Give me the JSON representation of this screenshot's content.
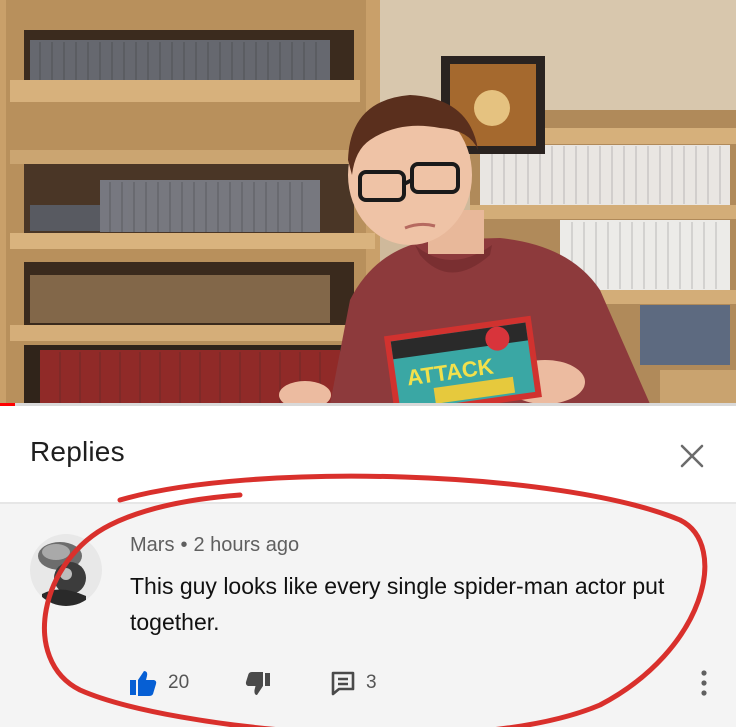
{
  "video": {
    "progress_fraction": 0.02,
    "box_art_text": "ATTACK"
  },
  "replies": {
    "title": "Replies",
    "close_icon": "close-icon"
  },
  "comment": {
    "author": "Mars",
    "separator": "•",
    "timestamp": "2 hours ago",
    "text": "This guy looks like every single spider-man actor put together.",
    "likes": "20",
    "reply_count": "3",
    "icons": {
      "like": "thumbs-up-icon",
      "dislike": "thumbs-down-icon",
      "reply": "reply-comment-icon",
      "more": "more-vert-icon"
    },
    "colors": {
      "like_active": "#065fd4",
      "annotation": "#d9302c"
    }
  }
}
